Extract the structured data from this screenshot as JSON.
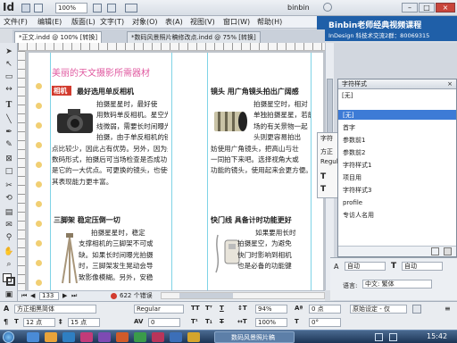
{
  "app": {
    "logo": "Id",
    "zoom": "100%",
    "user": "binbin"
  },
  "menu": [
    "文件(F)",
    "编辑(E)",
    "版面(L)",
    "文字(T)",
    "对象(O)",
    "表(A)",
    "视图(V)",
    "窗口(W)",
    "帮助(H)"
  ],
  "tabs": [
    {
      "label": "*正文.indd @ 100% [转换]"
    },
    {
      "label": "*数码风景照片稿修改点.indd @ 75% [转换]"
    }
  ],
  "brand": {
    "line1": "Binbin老师经典视频课程",
    "line2": "InDesign 科技术交流2群：80069315"
  },
  "document": {
    "title": "美丽的天文摄影所需器材",
    "sec1": {
      "label": "相机",
      "heading": "最好选用单反相机",
      "lines": [
        "拍摄星星时，最好使",
        "用数码单反相机。星空光",
        "线微弱，需要长时间曝光",
        "拍摄，由于单反相机的镜",
        "点比较少，因此占有优势。另外，因为是",
        "数码形式，拍摄后可当场检查是否成功，",
        "是它的一大优点。可更换的镜头，也使得",
        "其表现能力更丰富。"
      ]
    },
    "sec2": {
      "heading": "镜头 用广角镜头拍出广阔感",
      "lines": [
        "拍摄星空时，相对",
        "单独拍摄星星，若能",
        "场的有关景物一起",
        "头则更容易拍出",
        "妨使用广角镜头，把高山与壮",
        "一同拍下来吧。选择视角大或",
        "功能的镜头，使用起来会更方便。"
      ]
    },
    "sec3": {
      "heading": "三脚架 稳定压倒一切",
      "lines": [
        "拍摄星星时，稳定",
        "支撑相机的三脚架不可或",
        "缺。如果长时间曝光拍摄",
        "时，三脚架发生晃动会导",
        "致影像模糊。另外，安稳"
      ]
    },
    "sec4": {
      "heading": "快门线 具备计时功能更好",
      "lines": [
        "如果要用长时",
        "拍摄星空，为避免",
        "快门时影响到相机",
        "也是必备的功能键"
      ]
    }
  },
  "status": {
    "page": "133",
    "errors": "622 个错误"
  },
  "panel": {
    "title": "字符样式",
    "selected_label": "[无]",
    "styles": [
      "[无]",
      "首字",
      "参数前1",
      "参数前2",
      "字符样式1",
      "项目用",
      "字符样式3",
      "profile",
      "专访人名用"
    ],
    "peek_title": "字符",
    "peek_font": "方正",
    "peek_style": "Regular",
    "auto1": "自动",
    "auto2": "自动",
    "lang_label": "语言:",
    "lang_value": "中文: 繁体"
  },
  "control": {
    "font": "方正细黑简体",
    "size": "12 点",
    "leading": "15 点",
    "style": "Regular",
    "tracking": "0",
    "scale1": "94%",
    "scale2": "100%",
    "baseline": "0 点",
    "angle": "0°",
    "kern": "原始设定 - 仅"
  },
  "taskbar": {
    "start": "",
    "active_task": "数码风景照片稿",
    "time": "15:42"
  },
  "colors": {
    "brand_bg": "#1f5fa8",
    "title_pink": "#e05aa0",
    "guide": "#7fd3e6",
    "hole": "#f1cf73",
    "accent_red": "#d23b2e"
  }
}
